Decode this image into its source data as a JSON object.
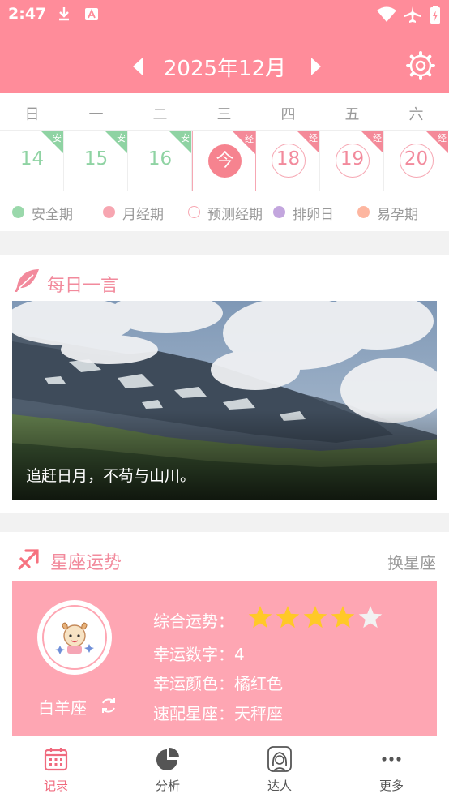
{
  "status_bar": {
    "time": "2:47",
    "icons": [
      "download-icon",
      "text-a-icon",
      "wifi-icon",
      "airplane-icon",
      "battery-charging-icon"
    ]
  },
  "header": {
    "month_title": "2025年12月",
    "prev_icon": "caret-left-icon",
    "next_icon": "caret-right-icon",
    "settings_icon": "gear-icon"
  },
  "calendar": {
    "weekdays": [
      "日",
      "一",
      "二",
      "三",
      "四",
      "五",
      "六"
    ],
    "days": [
      {
        "label": "14",
        "kind": "safe",
        "tag": "安"
      },
      {
        "label": "15",
        "kind": "safe",
        "tag": "安"
      },
      {
        "label": "16",
        "kind": "safe",
        "tag": "安"
      },
      {
        "label": "今",
        "kind": "today",
        "tag": "经"
      },
      {
        "label": "18",
        "kind": "period",
        "tag": "经"
      },
      {
        "label": "19",
        "kind": "period",
        "tag": "经"
      },
      {
        "label": "20",
        "kind": "period",
        "tag": "经"
      }
    ],
    "legend": [
      {
        "label": "安全期",
        "color": "#9ad8ab"
      },
      {
        "label": "月经期",
        "color": "#f7a6b1"
      },
      {
        "label": "预测经期",
        "color": "#ffffff"
      },
      {
        "label": "排卵日",
        "color": "#c3a6de"
      },
      {
        "label": "易孕期",
        "color": "#fdb6a0"
      }
    ]
  },
  "daily_quote": {
    "title": "每日一言",
    "icon": "feather-icon",
    "text": "追赶日月，不苟与山川。"
  },
  "horoscope": {
    "title": "星座运势",
    "icon": "sagittarius-arrow-icon",
    "change_label": "换星座",
    "sign_name": "白羊座",
    "refresh_icon": "refresh-icon",
    "overall_label": "综合运势：",
    "overall_stars": 4,
    "overall_max": 5,
    "lucky_number_label": "幸运数字：",
    "lucky_number": "4",
    "lucky_color_label": "幸运颜色：",
    "lucky_color": "橘红色",
    "match_label": "速配星座：",
    "match": "天秤座"
  },
  "bottom_nav": [
    {
      "label": "记录",
      "icon": "calendar-icon",
      "active": true
    },
    {
      "label": "分析",
      "icon": "pie-chart-icon",
      "active": false
    },
    {
      "label": "达人",
      "icon": "expert-avatar-icon",
      "active": false
    },
    {
      "label": "更多",
      "icon": "more-dots-icon",
      "active": false
    }
  ],
  "colors": {
    "header": "#ff8c9a",
    "accent": "#f28a9c",
    "safe": "#8fd3a3",
    "panel": "#fea6b3",
    "star": "#ffc927"
  }
}
